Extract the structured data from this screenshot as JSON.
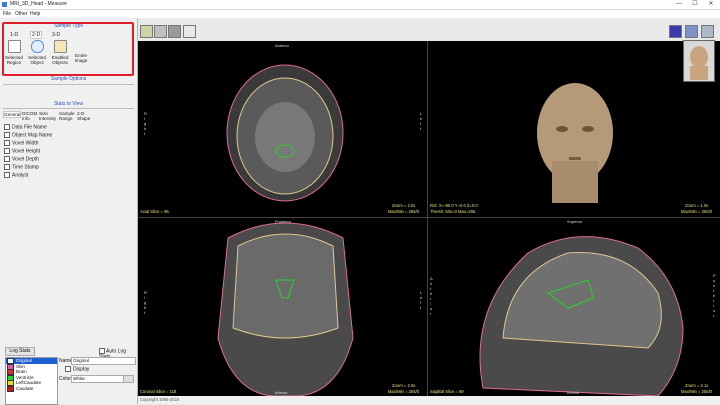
{
  "window": {
    "title": "MRI_3D_Head - Measure",
    "minimize": "—",
    "maximize": "☐",
    "close": "✕"
  },
  "menu": [
    "File",
    "Other",
    "Help"
  ],
  "sample_type": {
    "heading": "Sample Type",
    "tabs": [
      "1-D",
      "2-D",
      "3-D"
    ],
    "buttons": [
      {
        "label": "Selected Region",
        "icon": "selected-region-icon"
      },
      {
        "label": "Selected Object",
        "icon": "selected-object-icon"
      },
      {
        "label": "Enabled Objects",
        "icon": "enabled-objects-icon"
      },
      {
        "label": "Entire Image",
        "icon": "entire-image-icon"
      }
    ],
    "options_link": "Sample Options"
  },
  "stats": {
    "heading": "Stats to View",
    "columns": [
      "General",
      "DICOM Info",
      "Size",
      "Intensity",
      "Sample Range",
      "2-D Shape"
    ],
    "items": [
      "Data File Name",
      "Object Map Name",
      "Voxel Width",
      "Voxel Height",
      "Voxel Depth",
      "Time Stamp",
      "Analyst"
    ]
  },
  "bottom": {
    "log_button": "Log Stats",
    "auto_log": "Auto Log Stats",
    "objects": [
      {
        "name": "Original",
        "color": "#ffffff"
      },
      {
        "name": "Skin",
        "color": "#e05ab0"
      },
      {
        "name": "Brain",
        "color": "#e5e5a0"
      },
      {
        "name": "Ventricle",
        "color": "#29d129"
      },
      {
        "name": "LeftCaudate",
        "color": "#e0e020"
      },
      {
        "name": "Caudate",
        "color": "#d02020"
      }
    ],
    "name_label": "Name",
    "name_value": "Original",
    "display_label": "Display",
    "color_label": "Color",
    "color_value": "White"
  },
  "views": {
    "top_left": {
      "top": "Anterior",
      "side": "R i g h t",
      "right": "L e f t",
      "bottom_left": "Axial Slice = 96",
      "zoom": "Zoom = 2.0x",
      "minmax": "Max/Min = 255/0"
    },
    "top_right": {
      "bottom_left": "Rot: X=-90.0 Y=0.0 Z=0.0",
      "bottom_left2": "Thresh: Min=0 Max=255",
      "zoom": "Zoom = 1.0x",
      "minmax": "Max/Min = 255/0"
    },
    "bottom_left": {
      "top": "Posterior",
      "side": "R i g h t",
      "right": "L e f t",
      "bottom": "Inferior",
      "bottom_left": "Coronal Slice = 118",
      "zoom": "Zoom = 2.0x",
      "minmax": "Max/Min = 255/0"
    },
    "bottom_right": {
      "top": "Superior",
      "side": "A n t e r i o r",
      "right": "P o s t e r i o r",
      "bottom": "Inferior",
      "bottom_left": "Sagittal Slice = 89",
      "zoom": "Zoom = 2.1x",
      "minmax": "Max/Min = 255/0"
    }
  },
  "status": "Copyright 1986-2020"
}
